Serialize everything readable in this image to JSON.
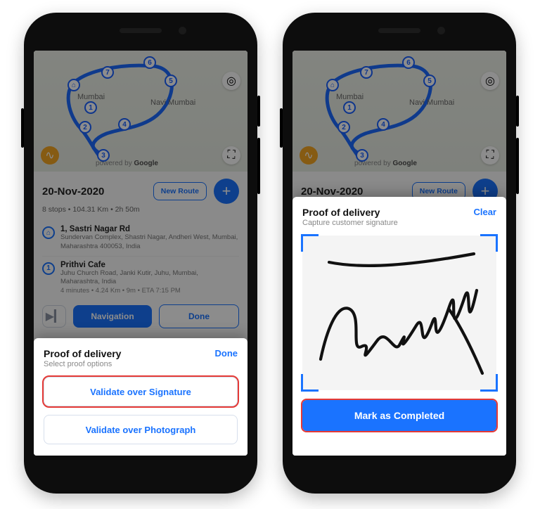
{
  "map": {
    "city1": "Mumbai",
    "city2": "Navi Mumbai",
    "credit_prefix": "powered by",
    "credit_brand": "Google",
    "waypoints": [
      "1",
      "2",
      "3",
      "4",
      "5",
      "6",
      "7"
    ]
  },
  "route": {
    "date": "20-Nov-2020",
    "summary": "8 stops • 104.31 Km • 2h 50m",
    "new_route_label": "New Route",
    "fab_glyph": "+"
  },
  "stop1": {
    "node_glyph": "⌂",
    "title": "1, Sastri Nagar Rd",
    "addr": "Sundervan Complex, Shastri Nagar, Andheri West, Mumbai, Maharashtra 400053, India"
  },
  "stop2": {
    "node_glyph": "1",
    "title": "Prithvi Cafe",
    "addr": "Juhu Church Road, Janki Kutir, Juhu, Mumbai, Maharashtra, India",
    "meta": "4 minutes • 4.24 Km • 9m • ETA 7:15 PM"
  },
  "actions": {
    "skip_glyph": "▶▎",
    "nav_label": "Navigation",
    "done_label": "Done"
  },
  "sheet_options": {
    "title": "Proof of delivery",
    "sub": "Select proof options",
    "done": "Done",
    "opt_signature": "Validate over Signature",
    "opt_photo": "Validate over Photograph"
  },
  "sheet_sign": {
    "title": "Proof of delivery",
    "sub": "Capture customer signature",
    "clear": "Clear",
    "complete": "Mark as Completed"
  },
  "icons": {
    "compass": "◎",
    "chart": "∿",
    "fullscreen": "⛶"
  }
}
